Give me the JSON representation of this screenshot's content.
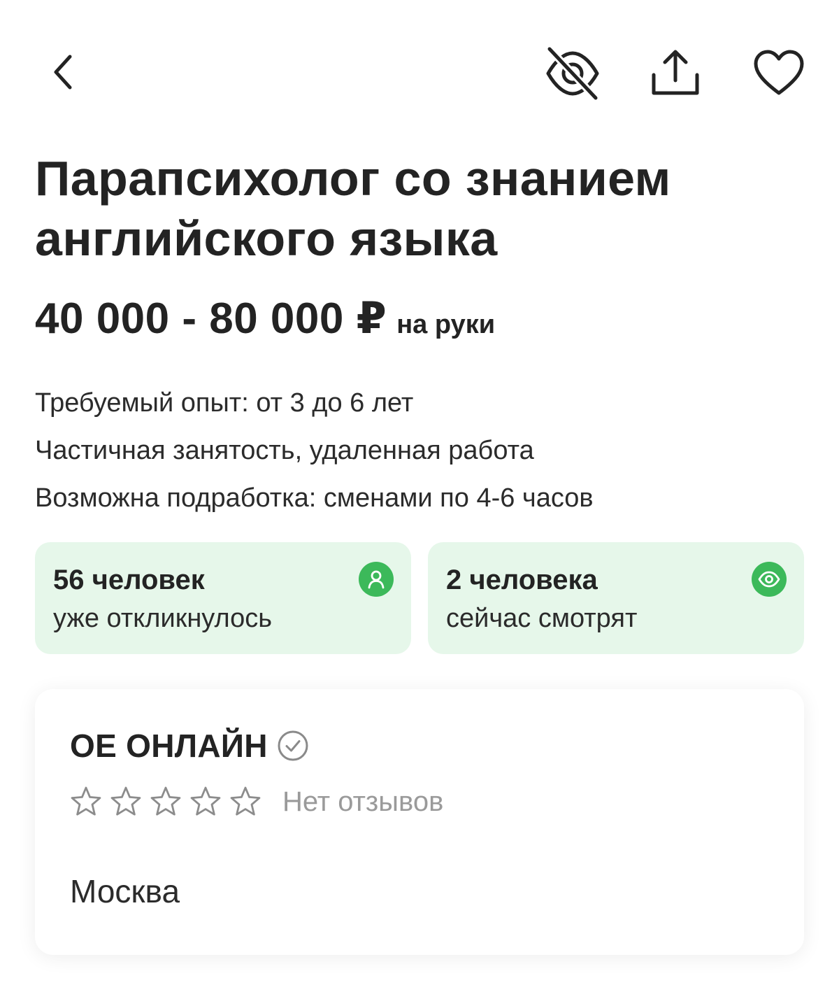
{
  "header": {
    "back_icon": "chevron-left-icon",
    "hide_icon": "eye-off-icon",
    "share_icon": "share-icon",
    "favorite_icon": "heart-icon"
  },
  "vacancy": {
    "title_line1": "Парапсихолог со знанием",
    "title_line2": "английского языка",
    "salary_amount": "40 000 - 80 000 ₽",
    "salary_suffix": "на руки",
    "experience": "Требуемый опыт: от 3 до 6 лет",
    "employment": "Частичная занятость, удаленная работа",
    "side_job": "Возможна подработка: сменами по 4-6 часов"
  },
  "stats": {
    "responses": {
      "number": "56 человек",
      "label": "уже откликнулось",
      "icon": "person-icon"
    },
    "viewers": {
      "number": "2 человека",
      "label": "сейчас смотрят",
      "icon": "eye-icon"
    }
  },
  "company": {
    "name": "ОЕ ОНЛАЙН",
    "verified_icon": "check-circle-icon",
    "rating_stars": 0,
    "rating_max": 5,
    "reviews": "Нет отзывов",
    "city": "Москва"
  },
  "colors": {
    "text": "#232323",
    "accent_green": "#3cb95a",
    "stat_background": "#e6f7ea",
    "muted": "#9a9a9a"
  }
}
